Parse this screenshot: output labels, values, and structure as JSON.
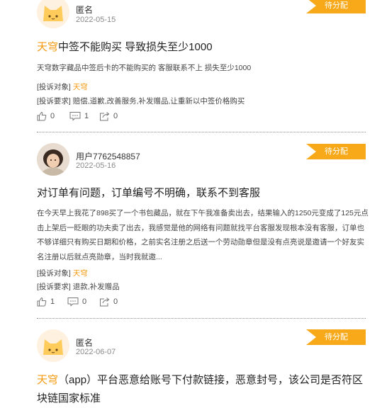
{
  "complaints": [
    {
      "user": "匿名",
      "date": "2022-05-15",
      "status": "待分配",
      "title_brand": "天穹",
      "title_rest": "中签不能购买 导致损失至少1000",
      "excerpt": "天穹数字藏品中签后卡的不能购买的 客服联系不上 损失至少1000",
      "target_label": "[投诉对象]",
      "target": "天穹",
      "demand_label": "[投诉要求]",
      "demand": "赔偿,道歉,改善服务,补发赠品,让重新以中签价格购买",
      "likes": "0",
      "comments": "1",
      "shares": "0"
    },
    {
      "user": "用户7762548857",
      "date": "2022-05-16",
      "status": "待分配",
      "title": "对订单有问题，订单编号不明确，联系不到客服",
      "excerpt": "在今天早上我花了898买了一个书包藏品，就在下午我准备卖出去，结果输入的1250元变成了125元点击上架后一眨眼的功夫卖了出去，我感觉是他的网络有问题就找平台客服发现根本没有客服，订单也不够详细只有购买日期和价格，之前实名注册之后送一个劳动勋章但是没有点亮说是邀请一个好友实名注册以后就点亮勋章，当时我就邀...",
      "target_label": "[投诉对象]",
      "target": "天穹",
      "demand_label": "[投诉要求]",
      "demand": "退款,补发赠品",
      "likes": "1",
      "comments": "0",
      "shares": "0"
    },
    {
      "user": "匿名",
      "date": "2022-06-07",
      "status": "待分配",
      "title_brand": "天穹",
      "title_rest": "（app）平台恶意给账号下付款链接，恶意封号，该公司是否符区块链国家标准"
    }
  ],
  "icons": [
    "anonymous-cat-avatar",
    "user-photo-avatar",
    "thumbs-up-icon",
    "comment-icon",
    "share-icon"
  ],
  "colors": {
    "badge": "#f8a91a",
    "brand": "#f59a10"
  }
}
